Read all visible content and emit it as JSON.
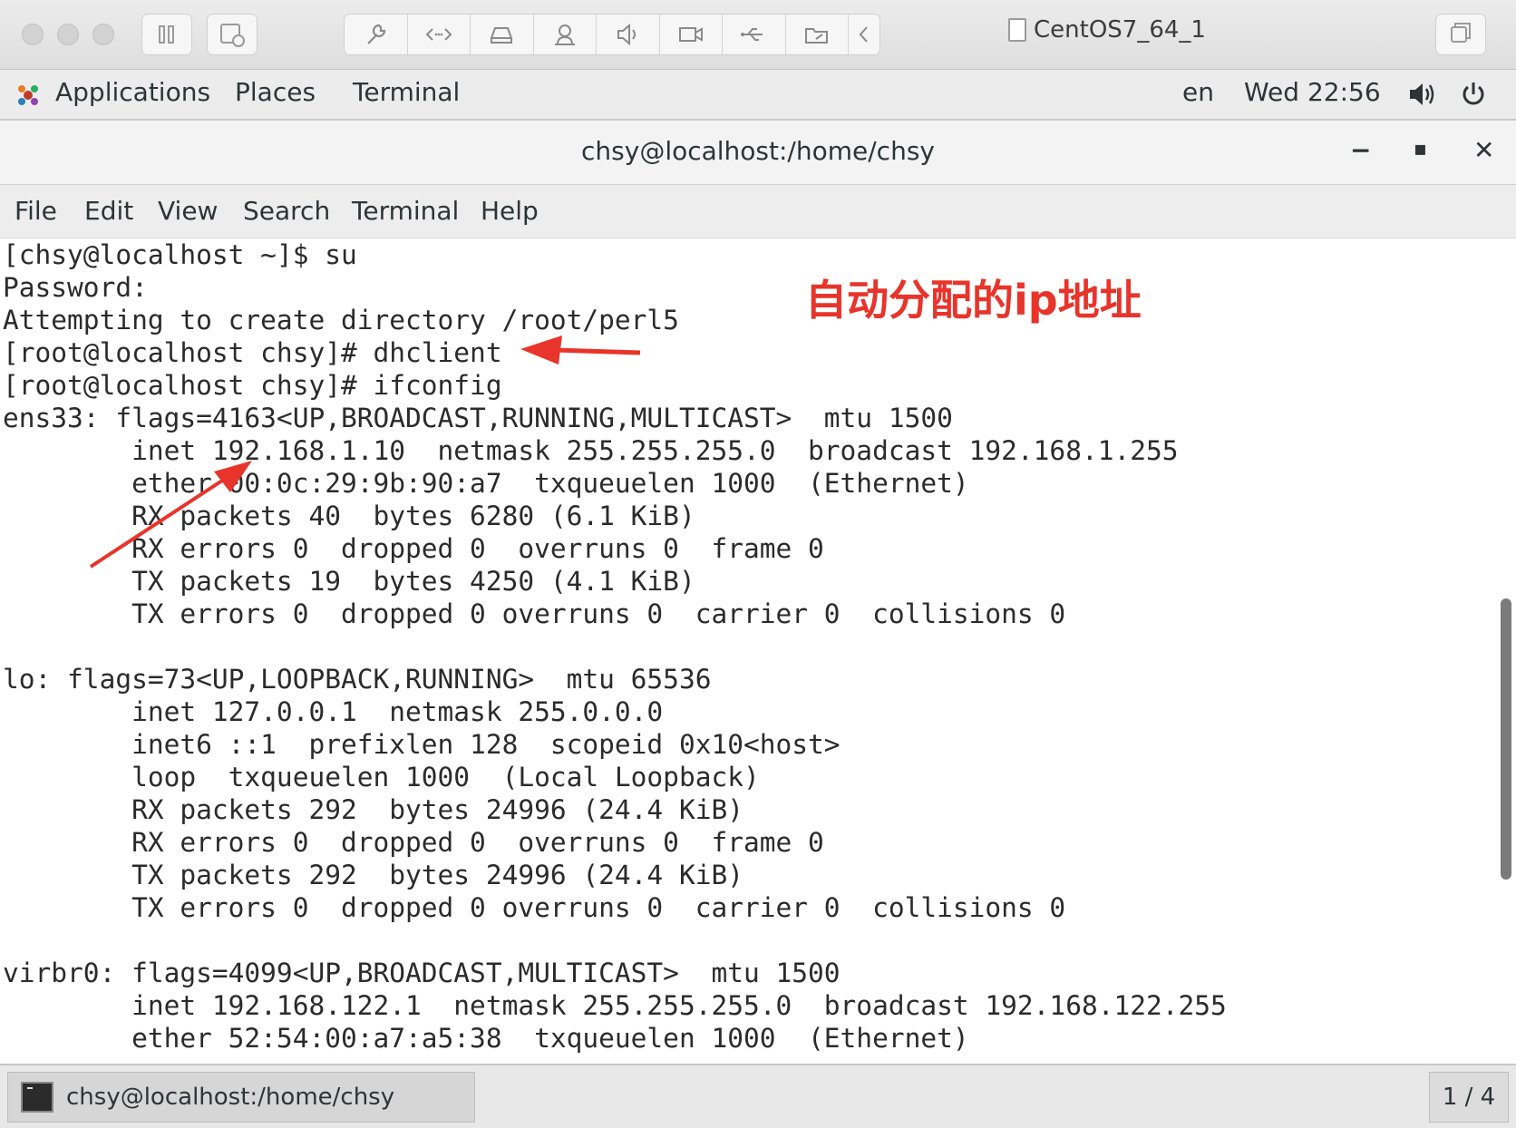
{
  "vm": {
    "title": "CentOS7_64_1",
    "toolbar_icons": [
      "wrench-icon",
      "code-icon",
      "disk-icon",
      "user-icon",
      "speaker-icon",
      "camera-icon",
      "usb-icon",
      "folder-icon",
      "chevron-left-icon"
    ]
  },
  "gnome": {
    "applications": "Applications",
    "places": "Places",
    "terminal": "Terminal",
    "lang": "en",
    "clock": "Wed 22:56"
  },
  "window": {
    "title": "chsy@localhost:/home/chsy",
    "minimize": "−",
    "maximize": "▪",
    "close": "✕"
  },
  "menu": [
    "File",
    "Edit",
    "View",
    "Search",
    "Terminal",
    "Help"
  ],
  "terminal": {
    "lines": [
      "[chsy@localhost ~]$ su",
      "Password:",
      "Attempting to create directory /root/perl5",
      "[root@localhost chsy]# dhclient",
      "[root@localhost chsy]# ifconfig",
      "ens33: flags=4163<UP,BROADCAST,RUNNING,MULTICAST>  mtu 1500",
      "        inet 192.168.1.10  netmask 255.255.255.0  broadcast 192.168.1.255",
      "        ether 00:0c:29:9b:90:a7  txqueuelen 1000  (Ethernet)",
      "        RX packets 40  bytes 6280 (6.1 KiB)",
      "        RX errors 0  dropped 0  overruns 0  frame 0",
      "        TX packets 19  bytes 4250 (4.1 KiB)",
      "        TX errors 0  dropped 0 overruns 0  carrier 0  collisions 0",
      "",
      "lo: flags=73<UP,LOOPBACK,RUNNING>  mtu 65536",
      "        inet 127.0.0.1  netmask 255.0.0.0",
      "        inet6 ::1  prefixlen 128  scopeid 0x10<host>",
      "        loop  txqueuelen 1000  (Local Loopback)",
      "        RX packets 292  bytes 24996 (24.4 KiB)",
      "        RX errors 0  dropped 0  overruns 0  frame 0",
      "        TX packets 292  bytes 24996 (24.4 KiB)",
      "        TX errors 0  dropped 0 overruns 0  carrier 0  collisions 0",
      "",
      "virbr0: flags=4099<UP,BROADCAST,MULTICAST>  mtu 1500",
      "        inet 192.168.122.1  netmask 255.255.255.0  broadcast 192.168.122.255",
      "        ether 52:54:00:a7:a5:38  txqueuelen 1000  (Ethernet)"
    ]
  },
  "annotation": {
    "text": "自动分配的ip地址",
    "color": "#e8342a"
  },
  "taskbar": {
    "task_label": "chsy@localhost:/home/chsy",
    "pager": "1 / 4"
  }
}
